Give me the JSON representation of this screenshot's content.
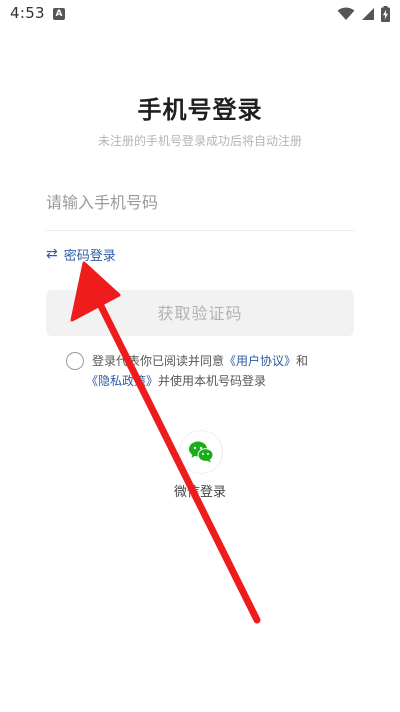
{
  "status_bar": {
    "time": "4:53",
    "app_indicator": "A",
    "icons": [
      "wifi-icon",
      "signal-icon",
      "battery-charging-icon"
    ]
  },
  "login": {
    "title": "手机号登录",
    "subtitle": "未注册的手机号登录成功后将自动注册",
    "phone_placeholder": "请输入手机号码",
    "phone_value": "",
    "password_login_label": "密码登录",
    "password_login_icon": "swap-icon",
    "get_code_label": "获取验证码",
    "get_code_enabled": false
  },
  "agreement": {
    "checked": false,
    "text_1": "登录代表你已阅读并同意",
    "user_agreement": "《用户协议》",
    "and": "和",
    "privacy_policy": "《隐私政策》",
    "text_2": "并使用本机号码登录"
  },
  "third_party": {
    "wechat_icon": "wechat-icon",
    "wechat_label": "微信登录"
  },
  "colors": {
    "link": "#2d5aa6",
    "wechat": "#1aad19",
    "annotation": "#ee1c1c",
    "button_bg": "#f2f2f2"
  }
}
